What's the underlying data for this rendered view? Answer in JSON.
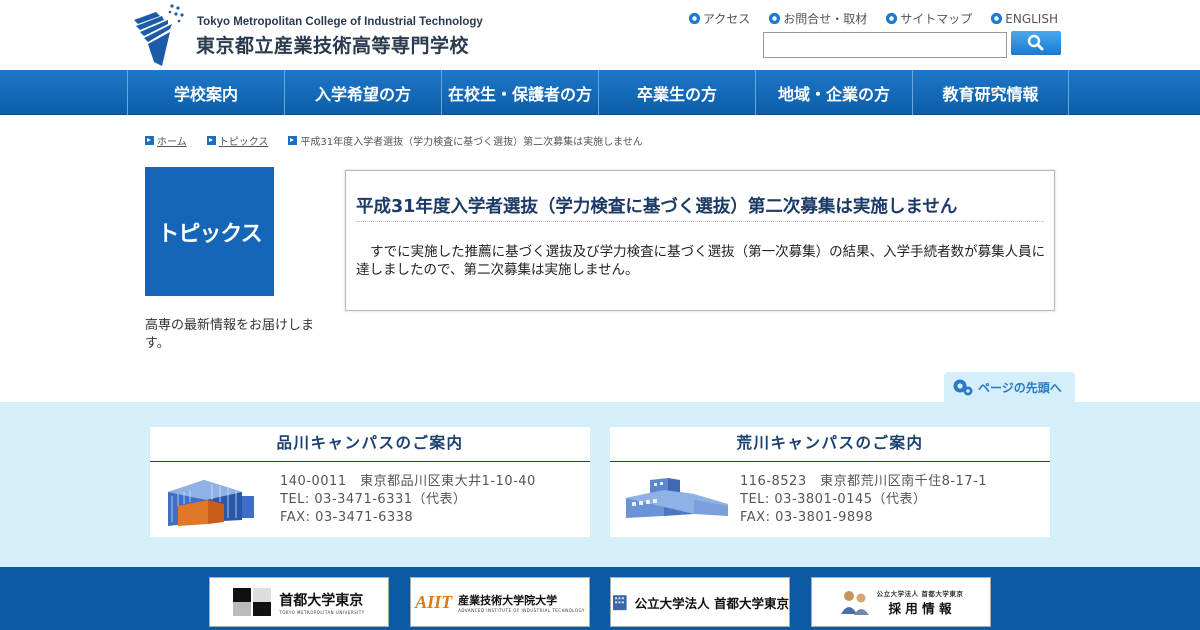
{
  "header": {
    "logo_en": "Tokyo Metropolitan College of Industrial Technology",
    "logo_ja": "東京都立産業技術高等専門学校",
    "links": [
      "アクセス",
      "お問合せ・取材",
      "サイトマップ",
      "ENGLISH"
    ],
    "search": {
      "value": "",
      "placeholder": ""
    }
  },
  "nav": {
    "items": [
      "学校案内",
      "入学希望の方",
      "在校生・保護者の方",
      "卒業生の方",
      "地域・企業の方",
      "教育研究情報"
    ]
  },
  "breadcrumb": [
    "ホーム",
    "トピックス",
    "平成31年度入学者選抜（学力検査に基づく選抜）第二次募集は実施しません"
  ],
  "side": {
    "title": "トピックス",
    "description": "高専の最新情報をお届けします。"
  },
  "article": {
    "title": "平成31年度入学者選抜（学力検査に基づく選抜）第二次募集は実施しません",
    "body": "すでに実施した推薦に基づく選抜及び学力検査に基づく選抜（第一次募集）の結果、入学手続者数が募集人員に達しましたので、第二次募集は実施しません。"
  },
  "pagetop": "ページの先頭へ",
  "campuses": [
    {
      "title": "品川キャンパスのご案内",
      "address": "140-0011　東京都品川区東大井1-10-40",
      "tel": "TEL: 03-3471-6331（代表）",
      "fax": "FAX: 03-3471-6338"
    },
    {
      "title": "荒川キャンパスのご案内",
      "address": "116-8523　東京都荒川区南千住8-17-1",
      "tel": "TEL: 03-3801-0145（代表）",
      "fax": "FAX: 03-3801-9898"
    }
  ],
  "banners": [
    {
      "title": "首都大学東京",
      "sub": "TOKYO METROPOLITAN UNIVERSITY"
    },
    {
      "title": "産業技術大学院大学",
      "sub": "ADVANCED INSTITUTE OF INDUSTRIAL TECHNOLOGY",
      "mark": "AIIT"
    },
    {
      "title": "公立大学法人 首都大学東京"
    },
    {
      "title": "採 用 情 報",
      "sub": "公立大学法人 首都大学東京"
    }
  ],
  "colors": {
    "primary": "#1565b8",
    "nav": "#0b5ea8",
    "light_band": "#d4effa",
    "heading": "#1b3a66"
  }
}
